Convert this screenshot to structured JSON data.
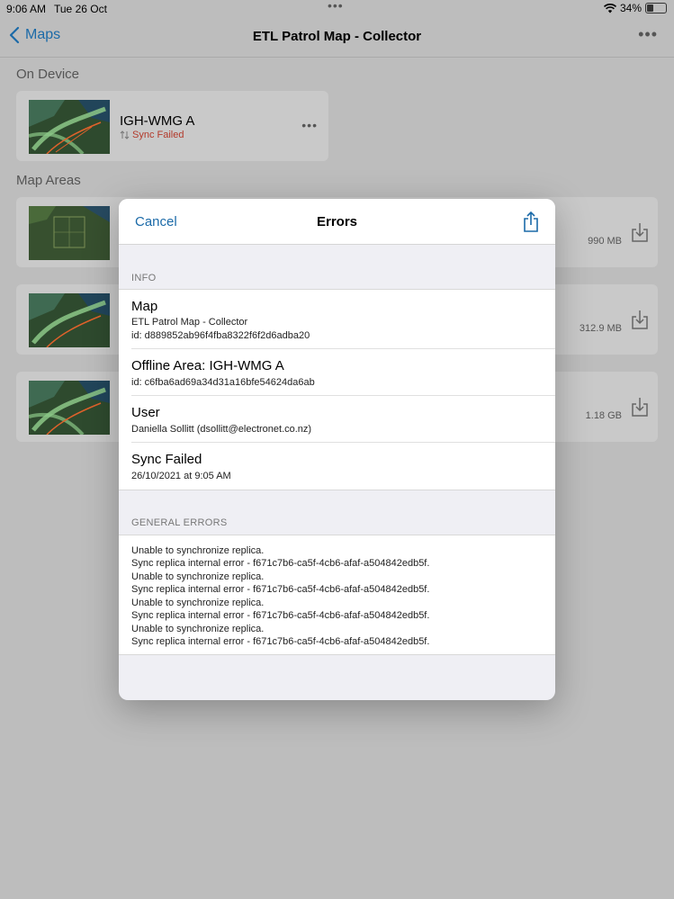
{
  "status": {
    "time": "9:06 AM",
    "date": "Tue 26 Oct",
    "battery": "34%",
    "battery_fraction": 0.34
  },
  "nav": {
    "back_label": "Maps",
    "title": "ETL Patrol Map - Collector"
  },
  "on_device": {
    "section_label": "On Device",
    "item": {
      "title": "IGH-WMG A",
      "status": "Sync Failed"
    }
  },
  "map_areas": {
    "section_label": "Map Areas",
    "items": [
      {
        "size": "990 MB"
      },
      {
        "size": "312.9 MB"
      },
      {
        "size": "1.18 GB"
      }
    ]
  },
  "modal": {
    "cancel_label": "Cancel",
    "title": "Errors",
    "info_header": "INFO",
    "info": {
      "map": {
        "title": "Map",
        "line1": "ETL Patrol Map - Collector",
        "line2": "id: d889852ab96f4fba8322f6f2d6adba20"
      },
      "offline": {
        "title": "Offline Area: IGH-WMG A",
        "line1": "id: c6fba6ad69a34d31a16bfe54624da6ab"
      },
      "user": {
        "title": "User",
        "line1": "Daniella Sollitt (dsollitt@electronet.co.nz)"
      },
      "sync": {
        "title": "Sync Failed",
        "line1": "26/10/2021 at 9:05 AM"
      }
    },
    "general_header": "GENERAL ERRORS",
    "errors": [
      "Unable to synchronize replica.",
      "Sync replica internal error - f671c7b6-ca5f-4cb6-afaf-a504842edb5f.",
      "Unable to synchronize replica.",
      "Sync replica internal error - f671c7b6-ca5f-4cb6-afaf-a504842edb5f.",
      "Unable to synchronize replica.",
      "Sync replica internal error - f671c7b6-ca5f-4cb6-afaf-a504842edb5f.",
      "Unable to synchronize replica.",
      "Sync replica internal error - f671c7b6-ca5f-4cb6-afaf-a504842edb5f."
    ]
  },
  "colors": {
    "accent": "#1b6aa8",
    "error": "#b33a2b",
    "dim_overlay": "#bdbdbd"
  },
  "icons": [
    "chevron-left-icon",
    "more-icon",
    "wifi-icon",
    "battery-icon",
    "sync-icon",
    "download-icon",
    "share-icon"
  ]
}
